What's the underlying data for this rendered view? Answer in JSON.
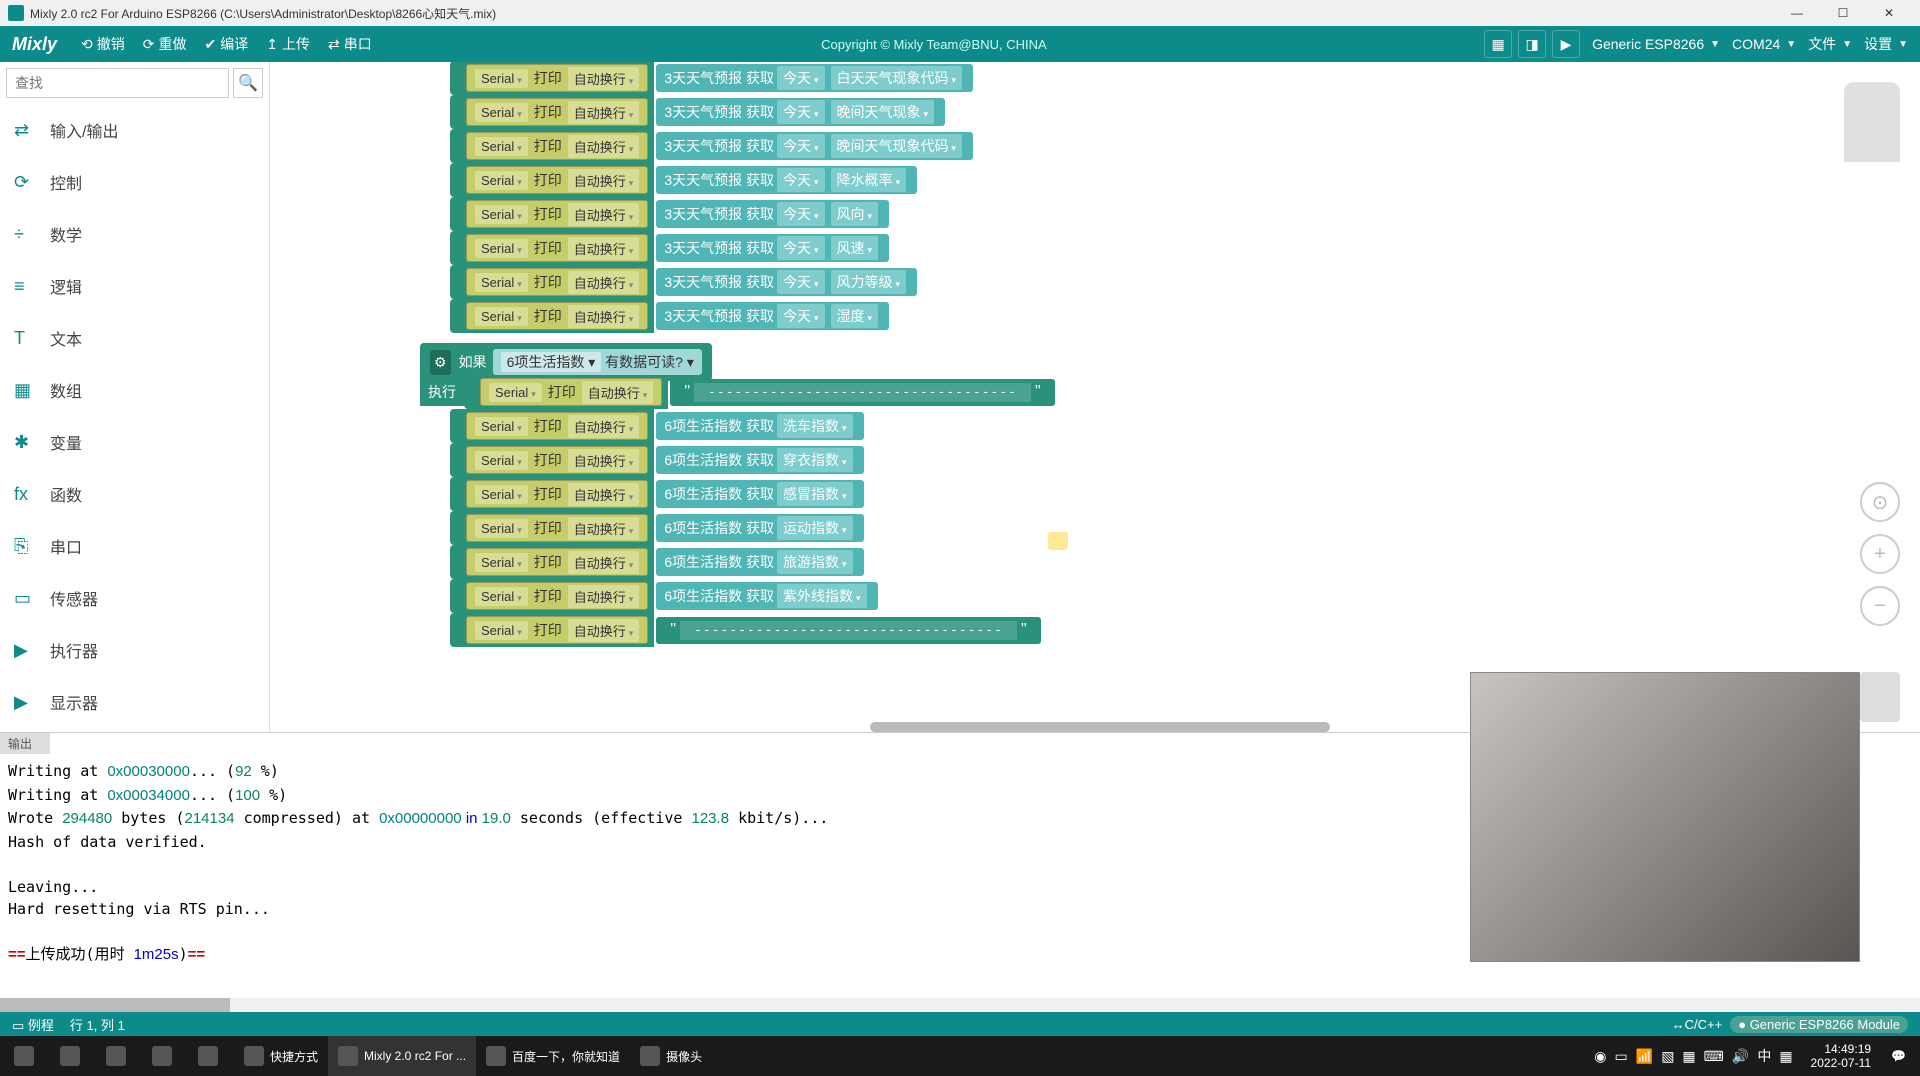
{
  "title": "Mixly 2.0 rc2 For Arduino ESP8266 (C:\\Users\\Administrator\\Desktop\\8266心知天气.mix)",
  "logo": "Mixly",
  "toolbar": {
    "undo": "撤销",
    "redo": "重做",
    "compile": "编译",
    "upload": "上传",
    "serial": "串口",
    "copyright": "Copyright © Mixly Team@BNU, CHINA",
    "board": "Generic ESP8266",
    "port": "COM24",
    "file": "文件",
    "settings": "设置"
  },
  "search": {
    "placeholder": "查找"
  },
  "categories": [
    "输入/输出",
    "控制",
    "数学",
    "逻辑",
    "文本",
    "数组",
    "变量",
    "函数",
    "串口",
    "传感器",
    "执行器",
    "显示器"
  ],
  "cat_icons": [
    "⇄",
    "⟳",
    "÷",
    "≡",
    "T",
    "▦",
    "✱",
    "fx",
    "⎘",
    "▭",
    "▶",
    "▶"
  ],
  "weather": {
    "serial": "Serial",
    "print": "打印",
    "autowrap": "自动换行",
    "forecast3": "3天天气预报",
    "get": "获取",
    "today": "今天",
    "fields": [
      "白天天气现象代码",
      "晚间天气现象",
      "晚间天气现象代码",
      "降水概率",
      "风向",
      "风速",
      "风力等级",
      "湿度"
    ]
  },
  "life": {
    "if": "如果",
    "exec": "执行",
    "index6": "6项生活指数",
    "hasdata": "有数据可读?",
    "serial": "Serial",
    "print": "打印",
    "autowrap": "自动换行",
    "get": "获取",
    "dashes": "-----------------------------------",
    "items": [
      "洗车指数",
      "穿衣指数",
      "感冒指数",
      "运动指数",
      "旅游指数",
      "紫外线指数"
    ]
  },
  "console": {
    "tab": "输出",
    "line1a": "Writing at ",
    "line1b": "0x00030000",
    "line1c": "... (",
    "line1d": "92",
    "line1e": " %)",
    "line2a": "Writing at ",
    "line2b": "0x00034000",
    "line2c": "... (",
    "line2d": "100",
    "line2e": " %)",
    "line3a": "Wrote ",
    "line3b": "294480",
    "line3c": " bytes (",
    "line3d": "214134",
    "line3e": " compressed) at ",
    "line3f": "0x00000000",
    "line3g": " in ",
    "line3h": "19.0",
    "line3i": " seconds (effective ",
    "line3j": "123.8",
    "line3k": " kbit/s)...",
    "line4": "Hash of data verified.",
    "line5": "",
    "line6": "Leaving...",
    "line7": "Hard resetting via RTS pin...",
    "line8": "",
    "line9a": "==",
    "line9b": "上传成功(用时 ",
    "line9c": "1m25s",
    "line9d": ")",
    "line9e": "=="
  },
  "status": {
    "example": "例程",
    "cursor": "行 1, 列 1",
    "lang": "C/C++",
    "board": "Generic ESP8266 Module"
  },
  "taskbar": {
    "items": [
      {
        "label": "",
        "icon": "win"
      },
      {
        "label": "",
        "icon": "brush"
      },
      {
        "label": "",
        "icon": "paint"
      },
      {
        "label": "",
        "icon": "calc"
      },
      {
        "label": "",
        "icon": "edge"
      },
      {
        "label": "快捷方式",
        "icon": "folder"
      },
      {
        "label": "Mixly 2.0 rc2 For ...",
        "icon": "mixly",
        "active": true
      },
      {
        "label": "百度一下，你就知道",
        "icon": "baidu"
      },
      {
        "label": "摄像头",
        "icon": "cam"
      }
    ],
    "ime": "中",
    "time": "14:49:19",
    "date": "2022-07-11"
  }
}
